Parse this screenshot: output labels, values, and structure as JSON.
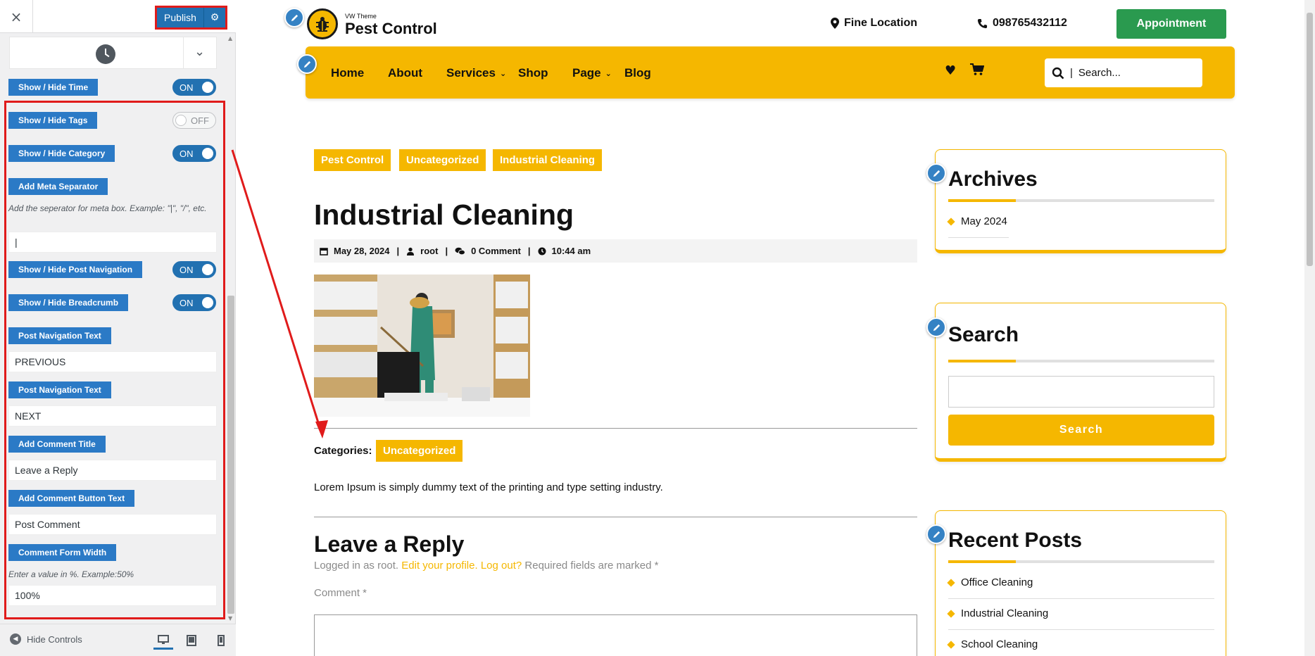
{
  "sidebar": {
    "close_icon": "×",
    "publish_label": "Publish",
    "settings": {
      "show_hide_time": {
        "label": "Show / Hide Time",
        "state": "ON"
      },
      "show_hide_tags": {
        "label": "Show / Hide Tags",
        "state": "OFF"
      },
      "show_hide_category": {
        "label": "Show / Hide Category",
        "state": "ON"
      },
      "meta_separator": {
        "label": "Add Meta Separator",
        "help": "Add the seperator for meta box. Example: \"|\", \"/\", etc.",
        "value": "|"
      },
      "show_hide_post_nav": {
        "label": "Show / Hide Post Navigation",
        "state": "ON"
      },
      "show_hide_breadcrumb": {
        "label": "Show / Hide Breadcrumb",
        "state": "ON"
      },
      "post_nav_prev": {
        "label": "Post Navigation Text",
        "value": "PREVIOUS"
      },
      "post_nav_next": {
        "label": "Post Navigation Text",
        "value": "NEXT"
      },
      "comment_title": {
        "label": "Add Comment Title",
        "value": "Leave a Reply"
      },
      "comment_button": {
        "label": "Add Comment Button Text",
        "value": "Post Comment"
      },
      "comment_width": {
        "label": "Comment Form Width",
        "help": "Enter a value in %. Example:50%",
        "value": "100%"
      }
    },
    "footer": {
      "hide_controls": "Hide Controls"
    }
  },
  "preview": {
    "logo_small": "VW Theme",
    "logo_title": "Pest Control",
    "location": "Fine Location",
    "phone": "098765432112",
    "appointment": "Appointment",
    "nav": [
      "Home",
      "About",
      "Services",
      "Shop",
      "Page",
      "Blog"
    ],
    "search_placeholder": "Search...",
    "post": {
      "tags": [
        "Pest Control",
        "Uncategorized",
        "Industrial Cleaning"
      ],
      "title": "Industrial Cleaning",
      "date": "May 28, 2024",
      "author": "root",
      "comments": "0 Comment",
      "time": "10:44 am",
      "categories_label": "Categories:",
      "category": "Uncategorized",
      "body": "Lorem Ipsum is simply dummy text of the printing and type setting industry."
    },
    "reply": {
      "title": "Leave a Reply",
      "logged_prefix": "Logged in as root.",
      "edit_profile": "Edit your profile.",
      "logout": "Log out?",
      "required": "Required fields are marked *",
      "comment_label": "Comment *"
    },
    "widgets": {
      "archives": {
        "title": "Archives",
        "items": [
          "May 2024"
        ]
      },
      "search": {
        "title": "Search",
        "button": "Search"
      },
      "recent": {
        "title": "Recent Posts",
        "items": [
          "Office Cleaning",
          "Industrial Cleaning",
          "School Cleaning"
        ]
      }
    }
  },
  "colors": {
    "accent_yellow": "#f5b700",
    "wp_blue": "#2271b1",
    "label_blue": "#2b7ac6",
    "appointment_green": "#2a9a4f",
    "highlight_red": "#e01b1b"
  }
}
